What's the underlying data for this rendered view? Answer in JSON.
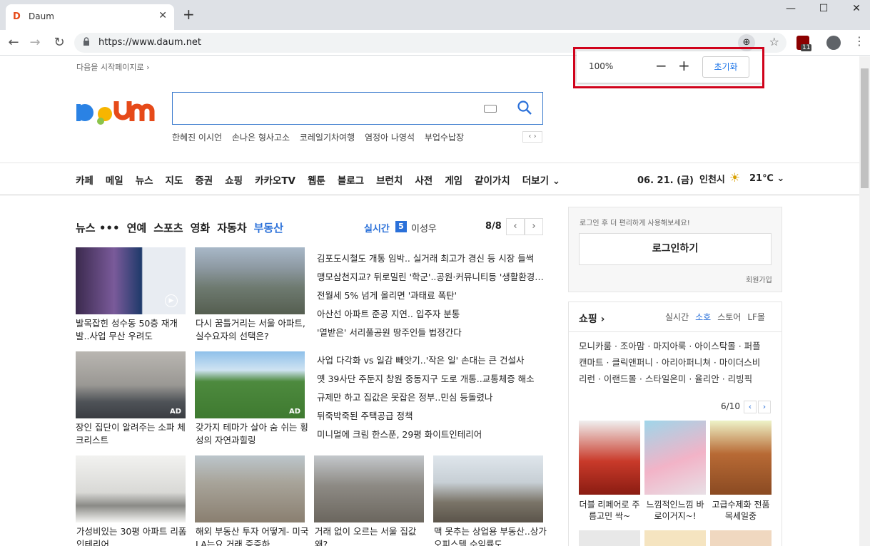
{
  "browser": {
    "tab_title": "Daum",
    "tab_close": "✕",
    "new_tab": "+",
    "url": "https://www.daum.net",
    "zoom_popup": {
      "level": "100%",
      "minus": "−",
      "plus": "+",
      "reset": "초기화"
    },
    "ext_badge": "11",
    "window": {
      "minimize": "—",
      "maximize": "☐",
      "close": "✕"
    }
  },
  "page": {
    "start_link": "다음을 시작페이지로 ›",
    "trending": [
      "한혜진 이시언",
      "손나은 형사고소",
      "코레일기차여행",
      "염정아 나영석",
      "부업수납장"
    ],
    "trend_nav": "‹ ›",
    "gnb": [
      "카페",
      "메일",
      "뉴스",
      "지도",
      "증권",
      "쇼핑",
      "카카오TV",
      "웹툰",
      "블로그",
      "브런치",
      "사전",
      "게임",
      "같이가치",
      "더보기 ⌄"
    ],
    "date": "06. 21. (금)",
    "city": "인천시",
    "temp": "21℃ ⌄",
    "news_tabs": [
      "뉴스 •••",
      "연예",
      "스포츠",
      "영화",
      "자동차",
      "부동산"
    ],
    "realtime_label": "실시간",
    "realtime_rank": "5",
    "realtime_name": "이성우",
    "pager": "8/8",
    "pager_prev": "‹",
    "pager_next": "›",
    "thumbs": [
      {
        "caption": "발목잡힌 성수동 50층 재개발..사업 무산 우려도"
      },
      {
        "caption": "다시 꿈틀거리는 서울 아파트, 실수요자의 선택은?"
      },
      {
        "caption": "장인 집단이 알려주는 소파 체크리스트"
      },
      {
        "caption": "갖가지 테마가 살아 숨 쉬는 횡성의 자연과힐링"
      },
      {
        "caption": "가성비있는 30평 아파트 리폼인테리어"
      },
      {
        "caption": "해외 부동산 투자 어떻게- 미국LA는요 거래 증증하"
      },
      {
        "caption": "거래 없이 오르는 서울 집값 왜?"
      },
      {
        "caption": "맥 못추는 상업용 부동산..상가오피스텔 수익률도"
      }
    ],
    "ad_label": "AD",
    "headlines": [
      "김포도시철도 개통 임박.. 실거래 최고가 경신 등 시장 들썩",
      "맹모삼천지교? 뒤로밀린 '학군'..공원·커뮤니티등 '생활환경'...",
      "전월세 5% 넘게 올리면 '과태료 폭탄'",
      "아산선 아파트 준공 지연.. 입주자 분통",
      "'열받은' 서리풀공원 땅주인들 법정간다",
      "사업 다각화 vs 일감 빼앗기..'작은 일' 손대는 큰 건설사",
      "옛 39사단 주둔지 창원 중동지구 도로 개통..교통체증 해소",
      "규제만 하고 집값은 못잡은 정부..민심 등돌렸나",
      "뒤죽박죽된 주택공급 정책",
      "미니멀에 크림 한스푼, 29평 화이트인테리어"
    ],
    "login": {
      "hint": "로그인 후 더 편리하게 사용해보세요!",
      "button": "로그인하기",
      "join": "회원가입"
    },
    "shopping": {
      "title": "쇼핑 ›",
      "tabs": [
        "실시간",
        "소호",
        "스토어",
        "LF몰"
      ],
      "brands_line1": "모니카룸 · 조아맘 · 마지아룩 · 아이스탁몰 · 퍼플",
      "brands_line2": "캔마트 · 클릭앤퍼니 · 아리아퍼니쳐 · 마이더스비",
      "brands_line3": "리런 · 이랜드몰 · 스타일온미 · 율리안 · 리빙픽",
      "page": "6/10",
      "products": [
        "더블 리페어로 주름고민 싹~",
        "느낌적인느낌 바로이거지~!",
        "고급수제화 전품목세일중"
      ]
    }
  },
  "colors": {
    "accent": "#2a70d9",
    "highlight": "#d0021b"
  }
}
